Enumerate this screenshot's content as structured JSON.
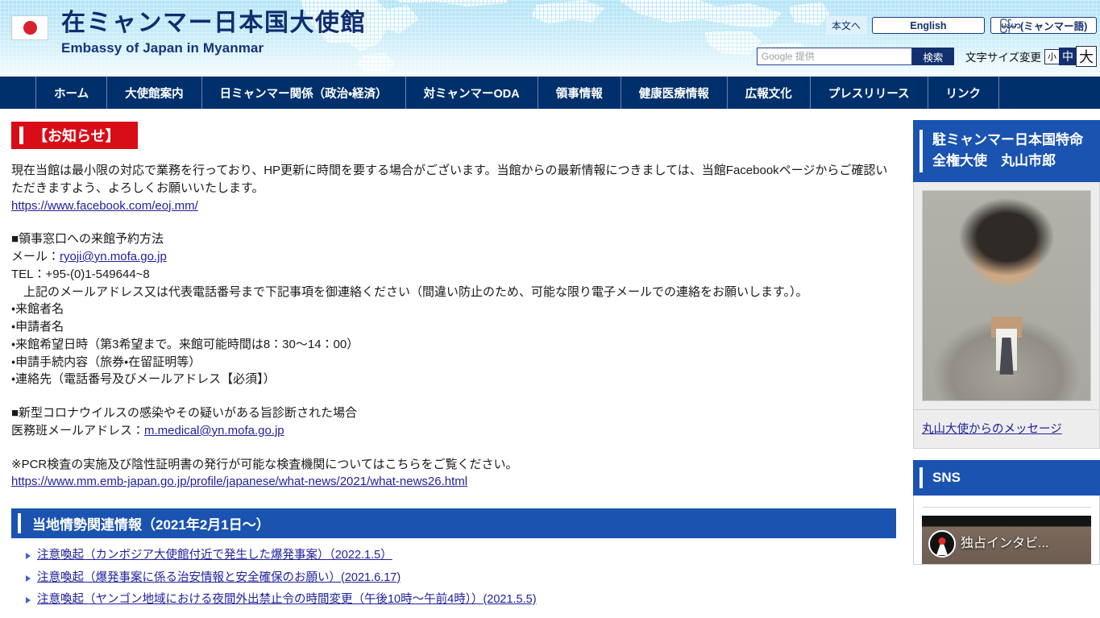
{
  "header": {
    "flag_icon": "japan-flag-icon",
    "title_ja": "在ミャンマー日本国大使館",
    "title_en": "Embassy of Japan in Myanmar",
    "skip_link": "本文へ",
    "lang_en": "English",
    "lang_my_burmese": "မြန်မာ",
    "lang_my_suffix": "(ミャンマー語)",
    "search_placeholder": "Google 提供",
    "search_value": "",
    "search_button": "検索",
    "fontsize_label": "文字サイズ変更",
    "fontsize_small": "小",
    "fontsize_medium": "中",
    "fontsize_large": "大",
    "fontsize_selected": "中"
  },
  "nav": {
    "items": [
      {
        "label": "ホーム"
      },
      {
        "label": "大使館案内"
      },
      {
        "label": "日ミャンマー関係（政治・経済）"
      },
      {
        "label": "対ミャンマーODA"
      },
      {
        "label": "領事情報"
      },
      {
        "label": "健康医療情報"
      },
      {
        "label": "広報文化"
      },
      {
        "label": "プレスリリース"
      },
      {
        "label": "リンク"
      }
    ]
  },
  "main": {
    "notice_heading": "【お知らせ】",
    "intro_line1": "現在当館は最小限の対応で業務を行っており、HP更新に時間を要する場合がございます。当館からの最新情報につきましては、当館Facebookページからご確認い",
    "intro_line2": "ただきますよう、よろしくお願いいたします。",
    "facebook_url": "https://www.facebook.com/eoj.mm/",
    "consular_heading": "■領事窓口への来館予約方法",
    "mail_label": "メール：",
    "mail_address": "ryoji@yn.mofa.go.jp",
    "tel_line": "TEL：+95-(0)1-549644~8",
    "instruction": "　上記のメールアドレス又は代表電話番号まで下記事項を御連絡ください（間違い防止のため、可能な限り電子メールでの連絡をお願いします。）。",
    "bullets": [
      "・来館者名",
      "・申請者名",
      "・来館希望日時（第3希望まで。来館可能時間は8：30〜14：00）",
      "・申請手続内容（旅券・在留証明等）",
      "・連絡先（電話番号及びメールアドレス【必須】）"
    ],
    "covid_heading": "■新型コロナウイルスの感染やその疑いがある旨診断された場合",
    "medical_label": "医務班メールアドレス：",
    "medical_address": "m.medical@yn.mofa.go.jp",
    "pcr_note": "※PCR検査の実施及び陰性証明書の発行が可能な検査機関についてはこちらをご覧ください。",
    "pcr_url": "https://www.mm.emb-japan.go.jp/profile/japanese/what-news/2021/what-news26.html",
    "situation_heading": "当地情勢関連情報（2021年2月1日〜）",
    "situation_links": [
      "注意喚起（カンボジア大使館付近で発生した爆発事案）（2022.1.5）",
      "注意喚起（爆発事案に係る治安情報と安全確保のお願い）(2021.6.17)",
      "注意喚起（ヤンゴン地域における夜間外出禁止令の時間変更（午後10時〜午前4時））(2021.5.5)"
    ]
  },
  "sidebar": {
    "ambassador_title": "駐ミャンマー日本国特命全権大使　丸山市郎",
    "ambassador_photo_alt": "ambassador-portrait",
    "ambassador_message_link": "丸山大使からのメッセージ",
    "sns_title": "SNS",
    "sns_video_title": "独占インタビ..."
  },
  "colors": {
    "nav_blue": "#00306b",
    "section_blue": "#1a53b0",
    "notice_red": "#d80d18",
    "link_blue": "#21219c",
    "header_gradient_top": "#b4e4f7"
  }
}
